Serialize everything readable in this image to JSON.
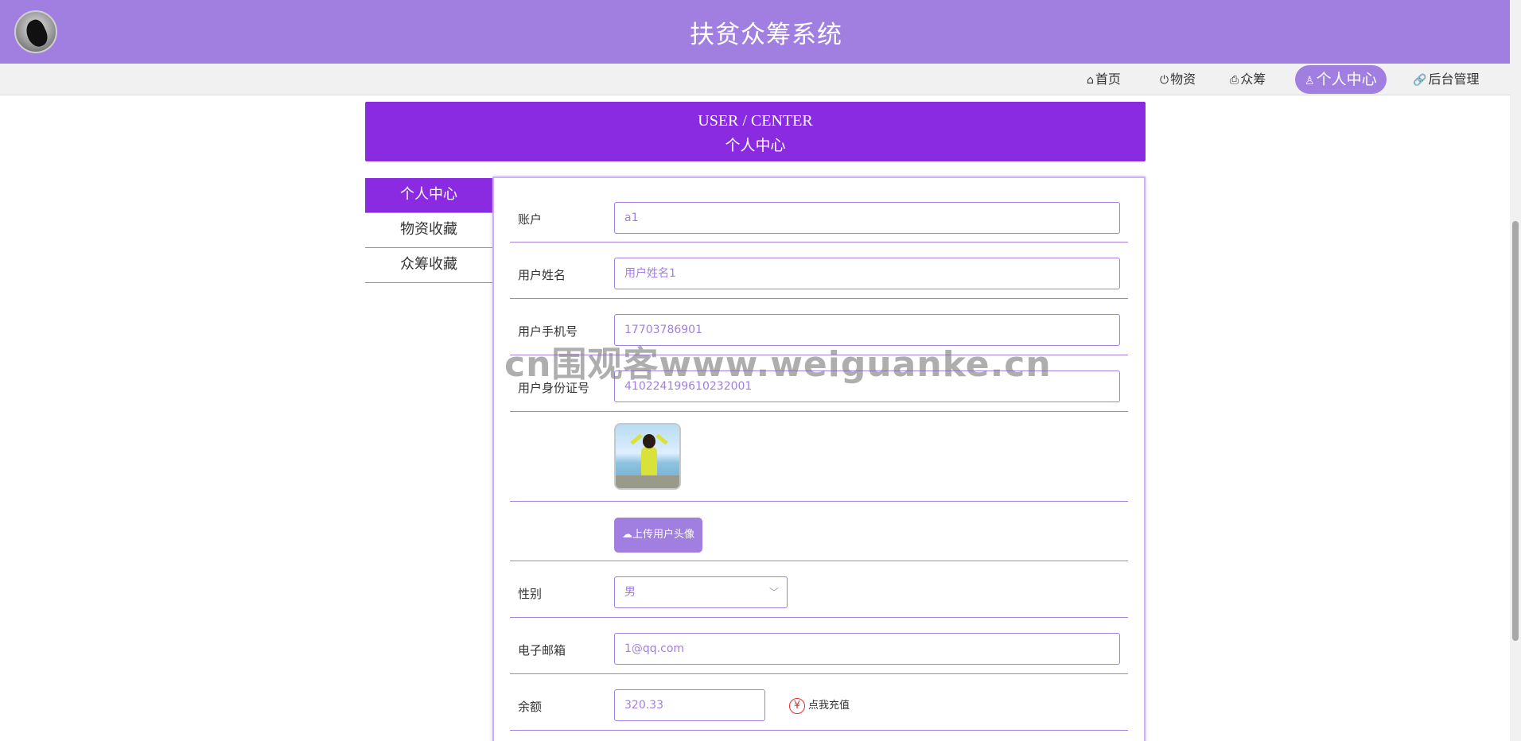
{
  "header": {
    "title": "扶贫众筹系统"
  },
  "nav": {
    "items": [
      {
        "icon": "⌂",
        "label": "首页"
      },
      {
        "icon": "⏻",
        "label": "物资"
      },
      {
        "icon": "⎙",
        "label": "众筹"
      },
      {
        "icon": "♙",
        "label": "个人中心"
      },
      {
        "icon": "🔗",
        "label": "后台管理"
      }
    ],
    "active_index": 3
  },
  "banner": {
    "en": "USER / CENTER",
    "cn": "个人中心"
  },
  "side_menu": {
    "items": [
      "个人中心",
      "物资收藏",
      "众筹收藏"
    ],
    "active_index": 0
  },
  "form": {
    "account": {
      "label": "账户",
      "value": "a1"
    },
    "username": {
      "label": "用户姓名",
      "value": "用户姓名1"
    },
    "phone": {
      "label": "用户手机号",
      "value": "17703786901"
    },
    "id_card": {
      "label": "用户身份证号",
      "value": "410224199610232001"
    },
    "upload_avatar": {
      "label": "上传用户头像",
      "icon": "cloud-upload-icon"
    },
    "gender": {
      "label": "性别",
      "value": "男"
    },
    "email": {
      "label": "电子邮箱",
      "value": "1@qq.com"
    },
    "balance": {
      "label": "余额",
      "value": "320.33",
      "recharge_label": "点我充值",
      "recharge_icon": "¥"
    }
  },
  "watermark": "cn围观客www.weiguanke.cn",
  "colors": {
    "primary": "#a17fe0",
    "accent": "#8a2be2"
  }
}
